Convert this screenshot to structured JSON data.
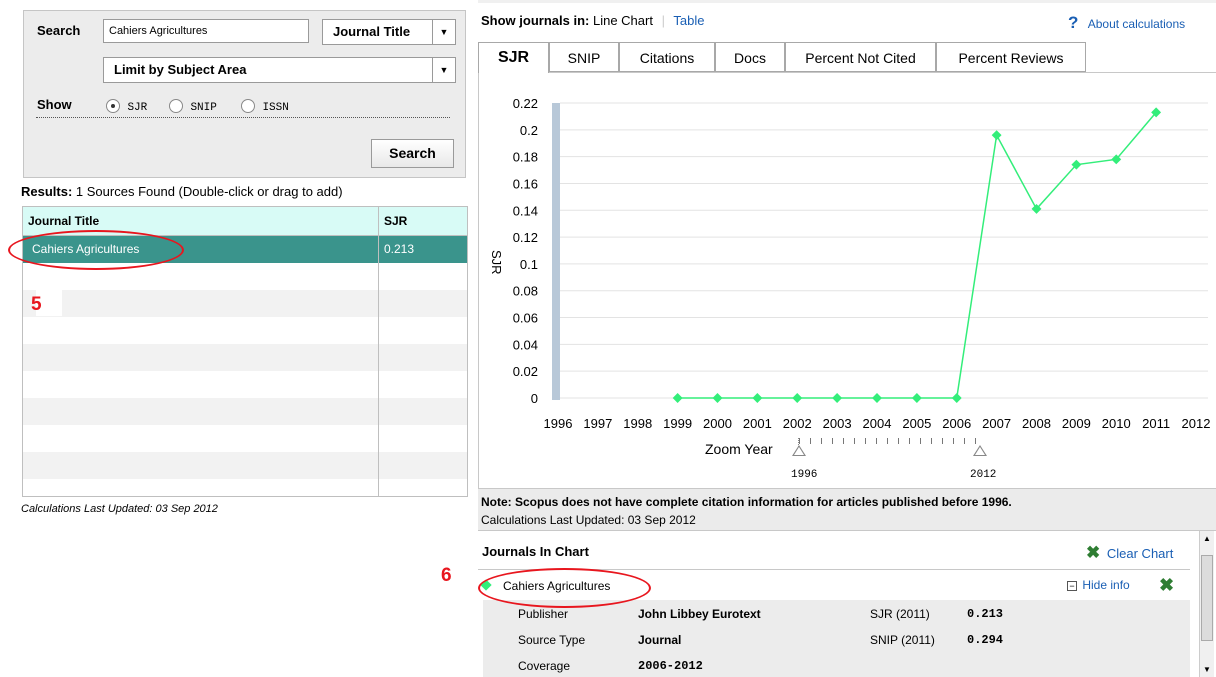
{
  "search": {
    "label": "Search",
    "value": "Cahiers Agricultures",
    "type_select": "Journal Title",
    "subject_select": "Limit by Subject Area",
    "show_label": "Show",
    "options": [
      "SJR",
      "SNIP",
      "ISSN"
    ],
    "selected": "SJR",
    "button": "Search"
  },
  "results": {
    "summary_bold": "Results:",
    "summary_text": "1 Sources Found (Double-click or drag to add)",
    "col_title": "Journal Title",
    "col_sjr": "SJR",
    "rows": [
      {
        "title": "Cahiers Agricultures",
        "sjr": "0.213"
      }
    ],
    "updated": "Calculations Last Updated: 03 Sep 2012"
  },
  "annotations": {
    "five": "5",
    "six": "6"
  },
  "view": {
    "show_label": "Show journals in:",
    "line_chart": "Line Chart",
    "table": "Table",
    "about": "About calculations"
  },
  "tabs": [
    "SJR",
    "SNIP",
    "Citations",
    "Docs",
    "Percent Not Cited",
    "Percent Reviews"
  ],
  "chart_data": {
    "type": "line",
    "ylabel": "SJR",
    "x": [
      1996,
      1997,
      1998,
      1999,
      2000,
      2001,
      2002,
      2003,
      2004,
      2005,
      2006,
      2007,
      2008,
      2009,
      2010,
      2011,
      2012
    ],
    "yticks": [
      "0.22",
      "0.2",
      "0.18",
      "0.16",
      "0.14",
      "0.12",
      "0.1",
      "0.08",
      "0.06",
      "0.04",
      "0.02",
      "0"
    ],
    "ylim": [
      0,
      0.22
    ],
    "series": [
      {
        "x": [
          1999,
          2000,
          2001,
          2002,
          2003,
          2004,
          2005,
          2006,
          2007,
          2008,
          2009,
          2010,
          2011
        ],
        "values": [
          0,
          0,
          0,
          0,
          0,
          0,
          0,
          0,
          0.196,
          0.141,
          0.174,
          0.178,
          0.213
        ],
        "color": "#33ee7a"
      }
    ],
    "grid": true
  },
  "zoom": {
    "label": "Zoom Year",
    "start": "1996",
    "end": "2012"
  },
  "notes": {
    "note": "Note: Scopus does not have complete citation information for articles published before 1996.",
    "updated": "Calculations Last Updated: 03 Sep 2012"
  },
  "journals_in_chart": {
    "header": "Journals In Chart",
    "clear": "Clear Chart",
    "journal": "Cahiers Agricultures",
    "hide": "Hide info",
    "info": {
      "publisher_label": "Publisher",
      "publisher": "John Libbey Eurotext",
      "source_type_label": "Source Type",
      "source_type": "Journal",
      "coverage_label": "Coverage",
      "coverage": "2006-2012",
      "sjr_label": "SJR (2011)",
      "sjr": "0.213",
      "snip_label": "SNIP (2011)",
      "snip": "0.294"
    }
  },
  "colors": {
    "accent": "#33ee7a",
    "selected_row": "#3a948c",
    "header_cyan": "#d8fbf6",
    "annotation": "#e8161e",
    "link": "#1a5fb4"
  }
}
